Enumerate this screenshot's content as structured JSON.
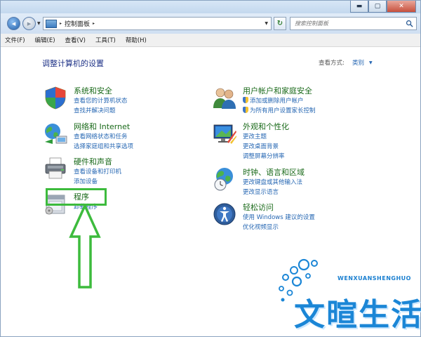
{
  "window": {
    "minimize": "▬",
    "maximize": "▢",
    "close": "✕"
  },
  "address": {
    "arrow1": "▸",
    "path": "控制面板",
    "arrow2": "▸",
    "search_placeholder": "搜索控制面板"
  },
  "menu": [
    "文件(F)",
    "编辑(E)",
    "查看(V)",
    "工具(T)",
    "帮助(H)"
  ],
  "page": {
    "title": "调整计算机的设置",
    "view_by_label": "查看方式:",
    "view_by_value": "类别"
  },
  "categories": [
    {
      "title": "系统和安全",
      "links": [
        "查看您的计算机状态",
        "查找并解决问题"
      ]
    },
    {
      "title": "网络和 Internet",
      "links": [
        "查看网络状态和任务",
        "选择家庭组和共享选项"
      ]
    },
    {
      "title": "硬件和声音",
      "links": [
        "查看设备和打印机",
        "添加设备"
      ]
    },
    {
      "title": "程序",
      "links": [
        "卸载程序"
      ]
    },
    {
      "title": "用户帐户和家庭安全",
      "links": [
        "添加或删除用户帐户",
        "为所有用户设置家长控制"
      ]
    },
    {
      "title": "外观和个性化",
      "links": [
        "更改主题",
        "更改桌面背景",
        "调整屏幕分辨率"
      ]
    },
    {
      "title": "时钟、语言和区域",
      "links": [
        "更改键盘或其他输入法",
        "更改显示语言"
      ]
    },
    {
      "title": "轻松访问",
      "links": [
        "使用 Windows 建议的设置",
        "优化视频显示"
      ]
    }
  ],
  "watermark": {
    "english": "WENXUANSHENGHUO",
    "chinese": "文暄生活"
  },
  "colors": {
    "category_title": "#1a6a1a",
    "link": "#2667b3",
    "page_title": "#1e3287",
    "annotation": "#3dbb3d",
    "watermark": "#1b86d6"
  }
}
